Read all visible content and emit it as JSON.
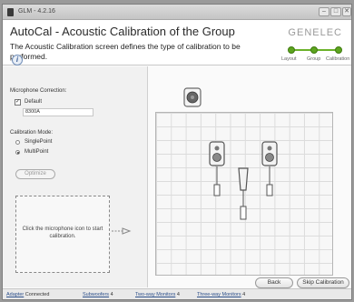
{
  "window": {
    "title": "GLM - 4.2.16",
    "controls": [
      "–",
      "□",
      "✕"
    ]
  },
  "header": {
    "title": "AutoCal - Acoustic Calibration of the Group",
    "brand": "GENELEC",
    "description": "The Acoustic Calibration screen defines the type of calibration to be performed.",
    "info_symbol": "i",
    "steps": [
      "Layout",
      "Group",
      "Calibration"
    ],
    "current_step": "Calibration"
  },
  "left": {
    "mic_heading": "Microphone Correction:",
    "default_label": "Default",
    "default_checked": true,
    "serial_value": "8300A",
    "mode_heading": "Calibration Mode:",
    "mode_options": [
      "SinglePoint",
      "MultiPoint"
    ],
    "mode_selected": "MultiPoint",
    "optimize_label": "Optimize",
    "mic_instruction": "Click the microphone icon to start calibration."
  },
  "buttons": {
    "back": "Back",
    "skip": "Skip Calibration"
  },
  "status": {
    "adapter_label": "Adapter",
    "adapter_value": "Connected",
    "subwoofers_label": "Subwoofers",
    "subwoofers_value": "4",
    "two_way_label": "Two-way Monitors",
    "two_way_value": "4",
    "three_way_label": "Three-way Monitors",
    "three_way_value": "4"
  },
  "colors": {
    "progress": "#5da51f",
    "link": "#2c4f8a"
  }
}
